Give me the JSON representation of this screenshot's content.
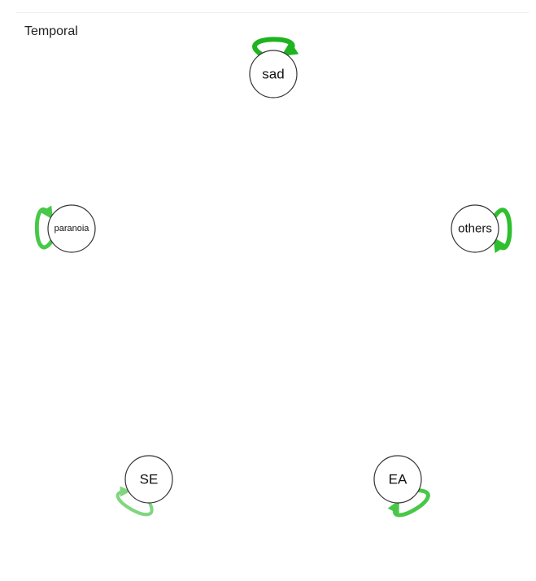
{
  "title": "Temporal",
  "nodes": [
    {
      "id": "sad",
      "label": "sad"
    },
    {
      "id": "others",
      "label": "others"
    },
    {
      "id": "EA",
      "label": "EA"
    },
    {
      "id": "SE",
      "label": "SE"
    },
    {
      "id": "paranoia",
      "label": "paranoia"
    }
  ],
  "edges": [
    {
      "from": "sad",
      "to": "sad",
      "type": "self-loop",
      "strength": 1.0,
      "color": "#1fb31f"
    },
    {
      "from": "others",
      "to": "others",
      "type": "self-loop",
      "strength": 0.85,
      "color": "#2fbf2f"
    },
    {
      "from": "EA",
      "to": "EA",
      "type": "self-loop",
      "strength": 0.7,
      "color": "#48c848"
    },
    {
      "from": "SE",
      "to": "SE",
      "type": "self-loop",
      "strength": 0.45,
      "color": "#7fd67f"
    },
    {
      "from": "paranoia",
      "to": "paranoia",
      "type": "self-loop",
      "strength": 0.7,
      "color": "#48c848"
    }
  ]
}
